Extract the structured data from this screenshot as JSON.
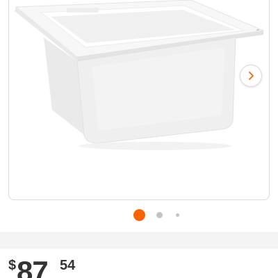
{
  "product": {
    "image_icon": "utility-sink-image",
    "next_icon": "chevron-right-icon",
    "carousel": {
      "total_indicators": 3,
      "active_index": 0
    }
  },
  "price": {
    "currency": "$",
    "dollars": "87",
    "cents": "54"
  },
  "colors": {
    "accent": "#f96302",
    "indicator_inactive": "#c4c4c4",
    "page_background": "#f4f4f4",
    "text": "#333333"
  }
}
